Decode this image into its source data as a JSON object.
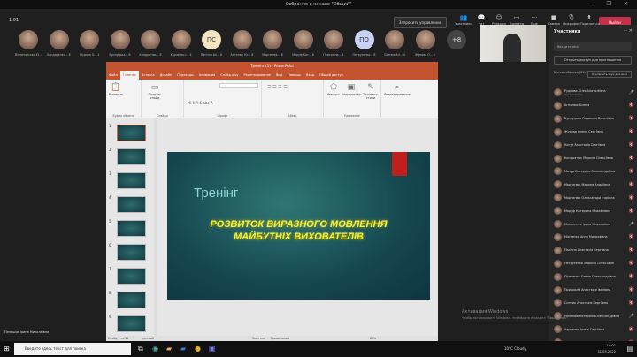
{
  "window": {
    "title": "Собрание в канале \"Общий\"",
    "controls": "– ❐ ✕"
  },
  "meeting": {
    "timer": "1:01",
    "request_control": "Запросить управление",
    "toolbar": [
      {
        "label": "Участники",
        "icon": "people-icon"
      },
      {
        "label": "Чат",
        "icon": "chat-icon"
      },
      {
        "label": "Реакции",
        "icon": "reactions-icon"
      },
      {
        "label": "Комнаты",
        "icon": "rooms-icon"
      },
      {
        "label": "Еще",
        "icon": "more-icon"
      },
      {
        "label": "Камера",
        "icon": "camera-icon"
      },
      {
        "label": "Микрофон",
        "icon": "mic-icon"
      },
      {
        "label": "Поделиться",
        "icon": "share-icon"
      }
    ],
    "leave": "Выйти",
    "overflow": "+8",
    "avatars": [
      {
        "name": "Вінничанська Ю..."
      },
      {
        "name": "Бондаренко...",
        "count": "8"
      },
      {
        "name": "Журава О...",
        "count": "4"
      },
      {
        "name": "Бурлуцька...",
        "count": "8"
      },
      {
        "name": "Кондратюк...",
        "count": "8"
      },
      {
        "name": "Харченко І...",
        "count": "4"
      },
      {
        "name": "Пасічна Ан...",
        "initials": "ПС",
        "count": "8"
      },
      {
        "name": "Антонюк Кс...",
        "count": "8"
      },
      {
        "name": "Мартинюк...",
        "count": "8"
      },
      {
        "name": "Маруф Кат...",
        "count": "8"
      },
      {
        "name": "Присяжна...",
        "count": "4"
      },
      {
        "name": "Петрусенко...",
        "initials": "ПО",
        "count": "8"
      },
      {
        "name": "Ситник Ан...",
        "count": "4"
      },
      {
        "name": "Жукова О...",
        "count": "4"
      }
    ]
  },
  "participants": {
    "title": "Участники",
    "search_placeholder": "Введите имя",
    "share_invite": "Открыть доступ для приглашения",
    "lobby_label": "В этом собрании (21)",
    "mute_all": "Отключить звук для всех",
    "items": [
      {
        "name": "Рудкова Юлія Анатоліївна",
        "role": "Организатор",
        "mic": "🎤"
      },
      {
        "name": "Антонюк Ксенія",
        "mic": "🔇"
      },
      {
        "name": "Бурлуцька Людмила Василівна",
        "mic": "🔇"
      },
      {
        "name": "Журава Олена Сергіївна",
        "mic": "🔇"
      },
      {
        "name": "Когут Анастасія Сергіївна",
        "mic": "🔇"
      },
      {
        "name": "Кондратюк Марина Олексіївна",
        "mic": "🔇"
      },
      {
        "name": "Мазур Катерина Олександрівна",
        "mic": "🔇"
      },
      {
        "name": "Мартинюк Марина Андріївна",
        "mic": "🔇"
      },
      {
        "name": "Мартинюк Олександра Ігорівна",
        "mic": "🔇"
      },
      {
        "name": "Маруф Катерина Михайлівна",
        "mic": "🔇"
      },
      {
        "name": "Мельничук Ірина Миколаївна",
        "mic": "🎤"
      },
      {
        "name": "Нікітенко Анна Миколаївна",
        "mic": "🔇"
      },
      {
        "name": "Пасічна Анастасія Сергіївна",
        "mic": "🔇"
      },
      {
        "name": "Петрусенко Марина Олексіївна",
        "mic": "🔇"
      },
      {
        "name": "Прилипко Олена Олександрівна",
        "mic": "🔇"
      },
      {
        "name": "Присяжна Анастасія Іванівна",
        "mic": "🔇"
      },
      {
        "name": "Ситник Анастасія Сергіївна",
        "mic": "🔇"
      },
      {
        "name": "Романюк Катерина Олександрівна",
        "mic": "🎤"
      },
      {
        "name": "Харченко Ірина Сергіївна",
        "mic": "🔇"
      },
      {
        "name": "Яременко Анастасія Валеріївна",
        "mic": "🔇"
      }
    ]
  },
  "ppt": {
    "title": "Тренінг (1) - PowerPoint",
    "tabs": [
      "Файл",
      "Главная",
      "Вставка",
      "Дизайн",
      "Переходы",
      "Анимация",
      "Слайд-шоу",
      "Рецензирование",
      "Вид",
      "Помощь",
      "Вход",
      "Общий доступ"
    ],
    "ribbon": {
      "paste": "Вставить",
      "new_slide": "Создать слайд",
      "shapes": "Фигуры",
      "arrange": "Упорядочить",
      "quick_styles": "Экспресс-стили",
      "editing": "Редактирование",
      "groups": [
        "Буфер обмена",
        "Слайды",
        "Шрифт",
        "Абзац",
        "Рисование"
      ]
    },
    "slide_numbers": [
      "1",
      "2",
      "3",
      "4",
      "5",
      "6",
      "7",
      "8",
      "9"
    ],
    "slide": {
      "title": "Тренінг",
      "subtitle": "РОЗВИТОК ВИРАЗНОГО МОВЛЕННЯ МАЙБУТНІХ ВИХОВАТЕЛІВ"
    },
    "status": {
      "slide": "Слайд 1 из 21",
      "lang": "русский",
      "notes": "Заметки",
      "comments": "Примечания",
      "zoom": "83%"
    }
  },
  "watermark": {
    "line1": "Активация Windows",
    "line2": "Чтобы активировать Windows, перейдите в раздел \"Параметры\"."
  },
  "presenter_caption": "Пелешок Ірина Миколаївна",
  "taskbar": {
    "search_placeholder": "Введите здесь текст для поиска",
    "weather": "10°C Cloudy",
    "time": "14:01",
    "date": "31.03.2022"
  }
}
